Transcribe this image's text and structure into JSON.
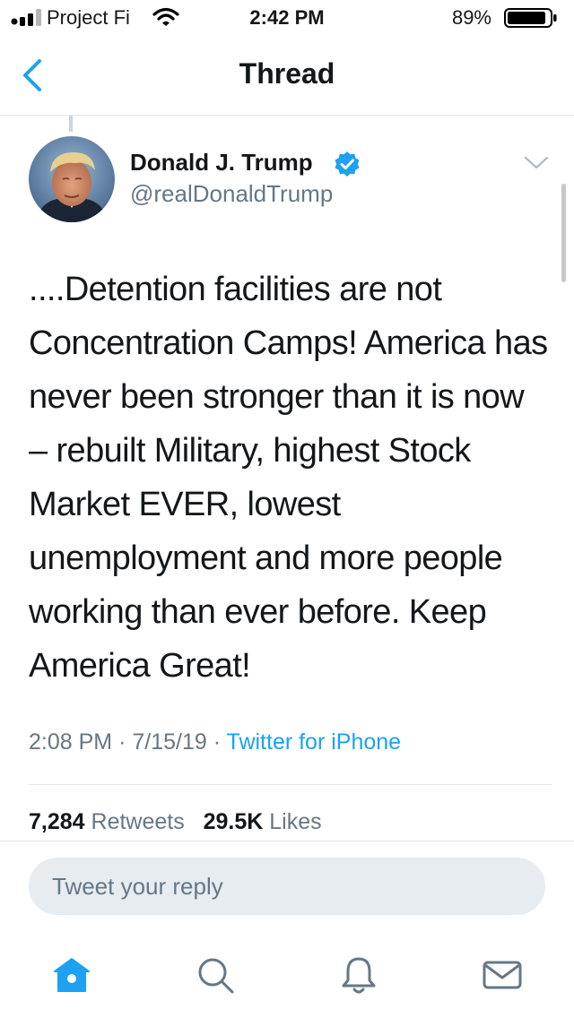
{
  "status_bar": {
    "carrier": "Project Fi",
    "time": "2:42 PM",
    "battery": "89%"
  },
  "nav": {
    "title": "Thread",
    "back_icon": "chevron-left-icon"
  },
  "tweet": {
    "author_name": "Donald J. Trump",
    "handle": "@realDonaldTrump",
    "verified": true,
    "text": "....Detention facilities are not Concentration Camps! America has never been stronger than it is now – rebuilt Military, highest Stock Market EVER, lowest unemployment and more people working than ever before. Keep America Great!",
    "time": "2:08 PM",
    "date": "7/15/19",
    "source": "Twitter for iPhone",
    "sep": "·",
    "retweets_count": "7,284",
    "retweets_label": "Retweets",
    "likes_count": "29.5K",
    "likes_label": "Likes"
  },
  "reply": {
    "placeholder": "Tweet your reply"
  },
  "tab_bar": {
    "items": [
      {
        "icon": "home-icon",
        "active": true
      },
      {
        "icon": "search-icon",
        "active": false
      },
      {
        "icon": "bell-icon",
        "active": false
      },
      {
        "icon": "mail-icon",
        "active": false
      }
    ]
  },
  "colors": {
    "accent": "#1da1f2",
    "secondary_text": "#657786",
    "divider": "#e1e8ed",
    "reply_bg": "#e6ecf0"
  }
}
